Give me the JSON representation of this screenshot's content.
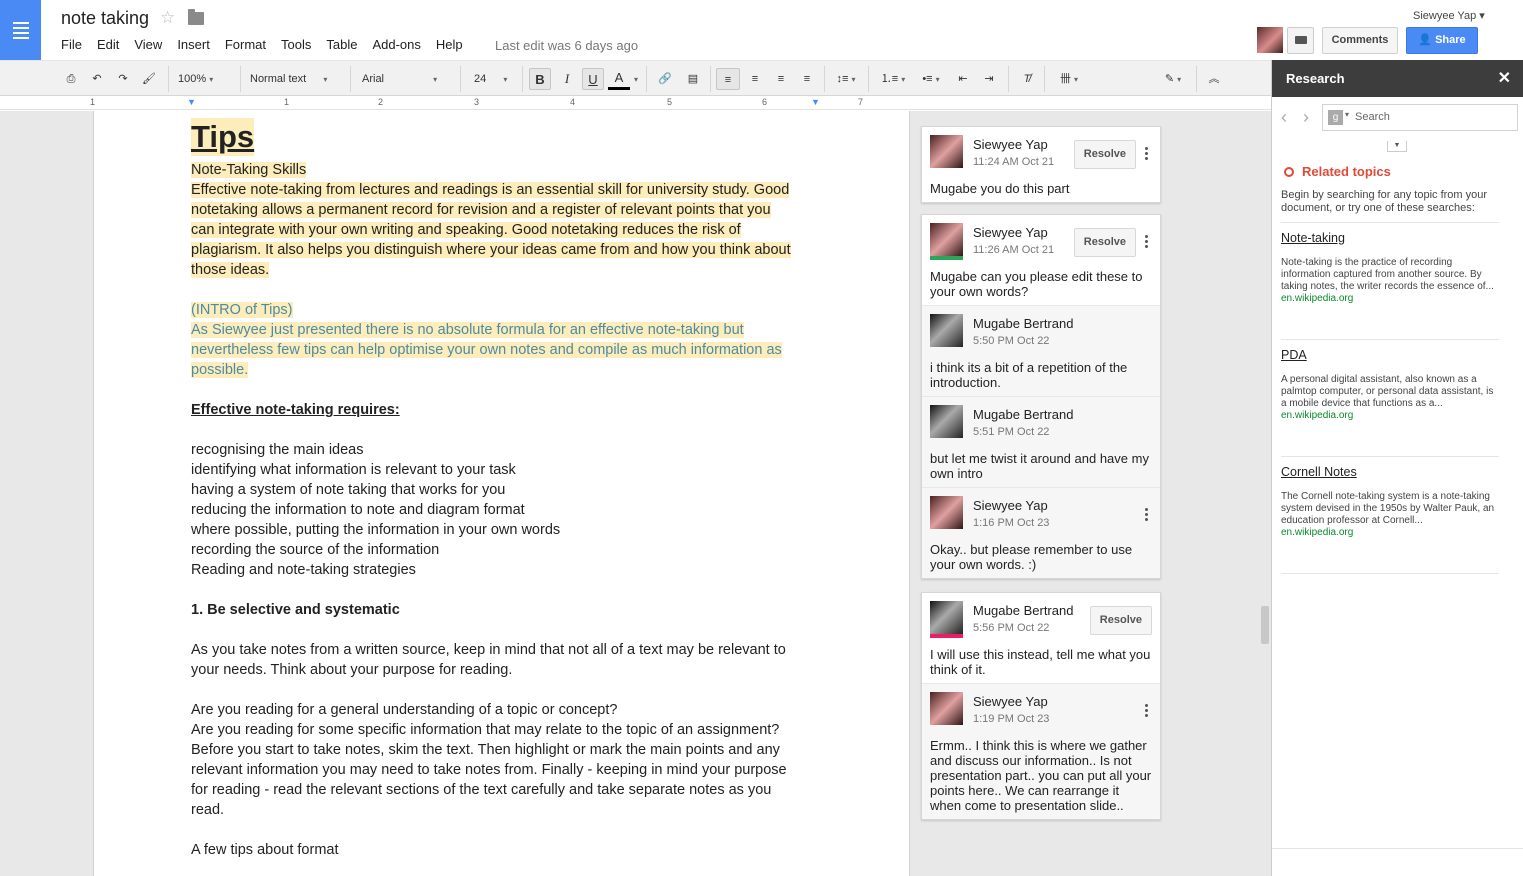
{
  "header": {
    "doc_title": "note taking",
    "menu": [
      "File",
      "Edit",
      "View",
      "Insert",
      "Format",
      "Tools",
      "Table",
      "Add-ons",
      "Help"
    ],
    "last_edit": "Last edit was 6 days ago",
    "user_name": "Siewyee Yap ▾",
    "comments_label": "Comments",
    "share_label": "Share"
  },
  "toolbar": {
    "zoom": "100%",
    "style": "Normal text",
    "font": "Arial",
    "size": "24",
    "bold": "B",
    "italic": "I",
    "underline": "U",
    "text_color": "A"
  },
  "ruler": [
    "1",
    "1",
    "2",
    "3",
    "4",
    "5",
    "6",
    "7"
  ],
  "document": {
    "heading": "Tips",
    "subtitle": "Note-Taking Skills",
    "intro_lines": [
      "Effective note-taking from lectures and readings is an essential skill for university study. Good",
      "notetaking allows a permanent record for revision and a register of relevant points that you",
      "can integrate with your own writing and speaking. Good notetaking reduces the risk of",
      "plagiarism. It also helps you distinguish where your ideas came from and how you think about",
      "those ideas."
    ],
    "teal_lines": [
      "(INTRO of Tips)",
      "As Siewyee just presented there is no absolute formula for an effective note-taking but",
      "nevertheless few tips can help optimise your own notes and compile as much information as",
      "possible."
    ],
    "requires_heading": "Effective note-taking requires:",
    "list": [
      "recognising the main ideas",
      "identifying what information is relevant to your task",
      "having a system of note taking that works for you",
      "reducing the information to note and diagram format",
      "where possible, putting the information in your own words",
      "recording the source of the information",
      "Reading and note-taking strategies"
    ],
    "section1_heading": "1. Be selective and systematic",
    "para1": [
      "As you take notes from a written source, keep in mind that not all of a text may be relevant to",
      "your needs. Think about your purpose for reading."
    ],
    "para2": [
      "Are you reading for a general understanding of a topic or concept?",
      "Are you reading for some specific information that may relate to the topic of an assignment?",
      "Before you start to take notes, skim the text. Then highlight or mark the main points and any",
      "relevant information you may need to take notes from. Finally - keeping in mind your purpose",
      "for reading - read the relevant sections of the text carefully and take separate notes as you",
      "read."
    ],
    "format_line": "A few tips about format"
  },
  "comments": [
    {
      "entries": [
        {
          "name": "Siewyee Yap",
          "time": "11:24 AM Oct 21",
          "body": "Mugabe you do this part",
          "resolve": "Resolve"
        }
      ]
    },
    {
      "entries": [
        {
          "name": "Siewyee Yap",
          "time": "11:26 AM Oct 21",
          "body": "Mugabe can you please edit these to your own words?",
          "resolve": "Resolve"
        },
        {
          "name": "Mugabe Bertrand",
          "time": "5:50 PM Oct 22",
          "body": "i think its a bit of a repetition of the introduction."
        },
        {
          "name": "Mugabe Bertrand",
          "time": "5:51 PM Oct 22",
          "body": "but let me twist it around and have my own intro"
        },
        {
          "name": "Siewyee Yap",
          "time": "1:16 PM Oct 23",
          "body": "Okay.. but please remember to use your own words. :)"
        }
      ]
    },
    {
      "entries": [
        {
          "name": "Mugabe Bertrand",
          "time": "5:56 PM Oct 22",
          "body": "I will use this instead, tell me what you think of it.",
          "resolve": "Resolve"
        },
        {
          "name": "Siewyee Yap",
          "time": "1:19 PM Oct 23",
          "body": "Ermm.. I think this is where we gather and discuss our information.. Is not presentation part.. you can put all your points here.. We can rearrange it when come to presentation slide.."
        }
      ]
    }
  ],
  "research": {
    "title": "Research",
    "close": "✕",
    "search_placeholder": "Search",
    "related_title": "Related topics",
    "related_desc": "Begin by searching for any topic from your document, or try one of these searches:",
    "topics": [
      {
        "title": "Note-taking",
        "snippet": "Note-taking is the practice of recording information captured from another source. By taking notes, the writer records the essence of...",
        "source": "en.wikipedia.org"
      },
      {
        "title": "PDA",
        "snippet": "A personal digital assistant, also known as a palmtop computer, or personal data assistant, is a mobile device that functions as a...",
        "source": "en.wikipedia.org"
      },
      {
        "title": "Cornell Notes",
        "snippet": "The Cornell note-taking system is a note-taking system devised in the 1950s by Walter Pauk, an education professor at Cornell...",
        "source": "en.wikipedia.org"
      }
    ]
  },
  "colors": {
    "accent": "#4a8af4",
    "highlight": "#fdedbb",
    "teal_text": "#4d8ba4",
    "link_green": "#0a8a2c",
    "related_red": "#dd4b39"
  }
}
